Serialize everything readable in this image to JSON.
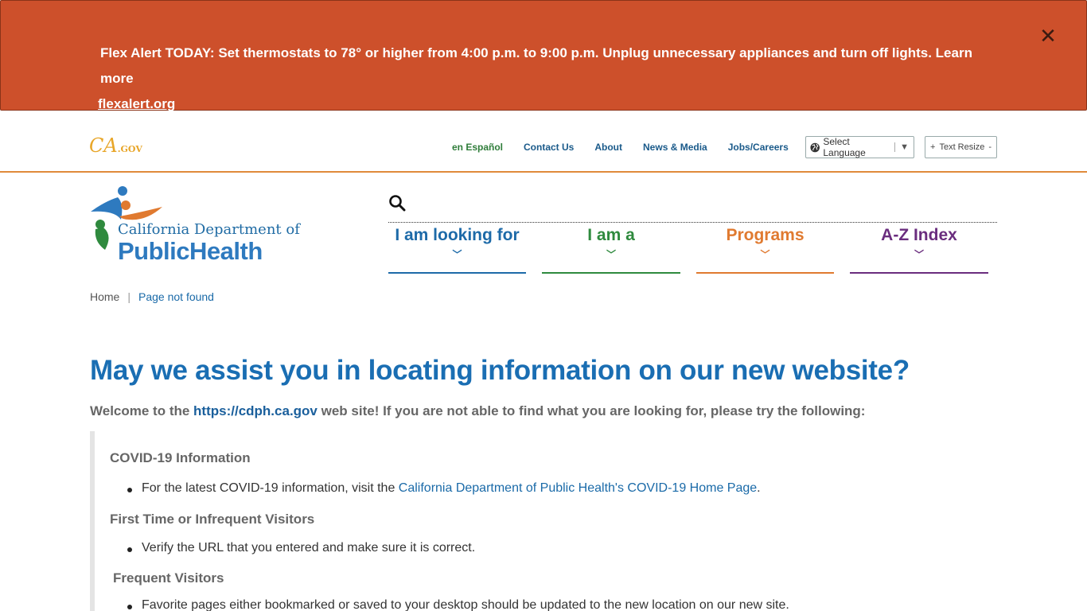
{
  "alert": {
    "text": "Flex Alert TODAY: Set thermostats to 78° or higher from 4:00 p.m. to 9:00 p.m. Unplug unnecessary appliances and turn off lights. Learn more",
    "link": "flexalert.org",
    "close": "✕"
  },
  "utility": {
    "ca_logo": "CA",
    "ca_logo_suffix": ".GOV",
    "links": [
      "en Español",
      "Contact Us",
      "About",
      "News & Media",
      "Jobs/Careers"
    ],
    "language": "Select Language",
    "language_arrow": "▼",
    "text_resize": "Text Resize",
    "plus": "+",
    "minus": "-"
  },
  "logo": {
    "line1": "California Department of",
    "line2": "PublicHealth"
  },
  "nav": [
    {
      "label": "I am looking for",
      "chevron": "﹀"
    },
    {
      "label": "I am a",
      "chevron": "﹀"
    },
    {
      "label": "Programs",
      "chevron": "﹀"
    },
    {
      "label": "A-Z Index",
      "chevron": "﹀"
    }
  ],
  "breadcrumb": {
    "home": "Home",
    "sep": "|",
    "current": "Page not found"
  },
  "main": {
    "title": "May we assist you in locating information on our new website?",
    "welcome_pre": "Welcome to the ",
    "welcome_link": "https://cdph.ca.gov",
    "welcome_post": " web site! If you are not able to find what you are looking for, please try the following:",
    "sections": [
      {
        "heading": "COVID-19 Information",
        "item_pre": "For the latest COVID-19 information, visit the ",
        "item_link": "California Department of Public Health's COVID-19 Home Page",
        "item_post": "."
      },
      {
        "heading": "First Time or Infrequent Visitors",
        "item": " Verify the URL that you entered and make sure it is correct."
      },
      {
        "heading": "Frequent Visitors",
        "item": "Favorite pages either bookmarked or saved to your desktop should be updated to the new location on our new site."
      }
    ]
  },
  "colors": {
    "alert_bg": "#cd502b",
    "title": "#1a6eb3",
    "nav_blue": "#1d6aa8",
    "nav_green": "#2f8a3e",
    "nav_orange": "#e07a30",
    "nav_purple": "#6a2d7e"
  },
  "icons": [
    "close-icon",
    "globe-icon",
    "search-icon",
    "chevron-down-icon"
  ]
}
